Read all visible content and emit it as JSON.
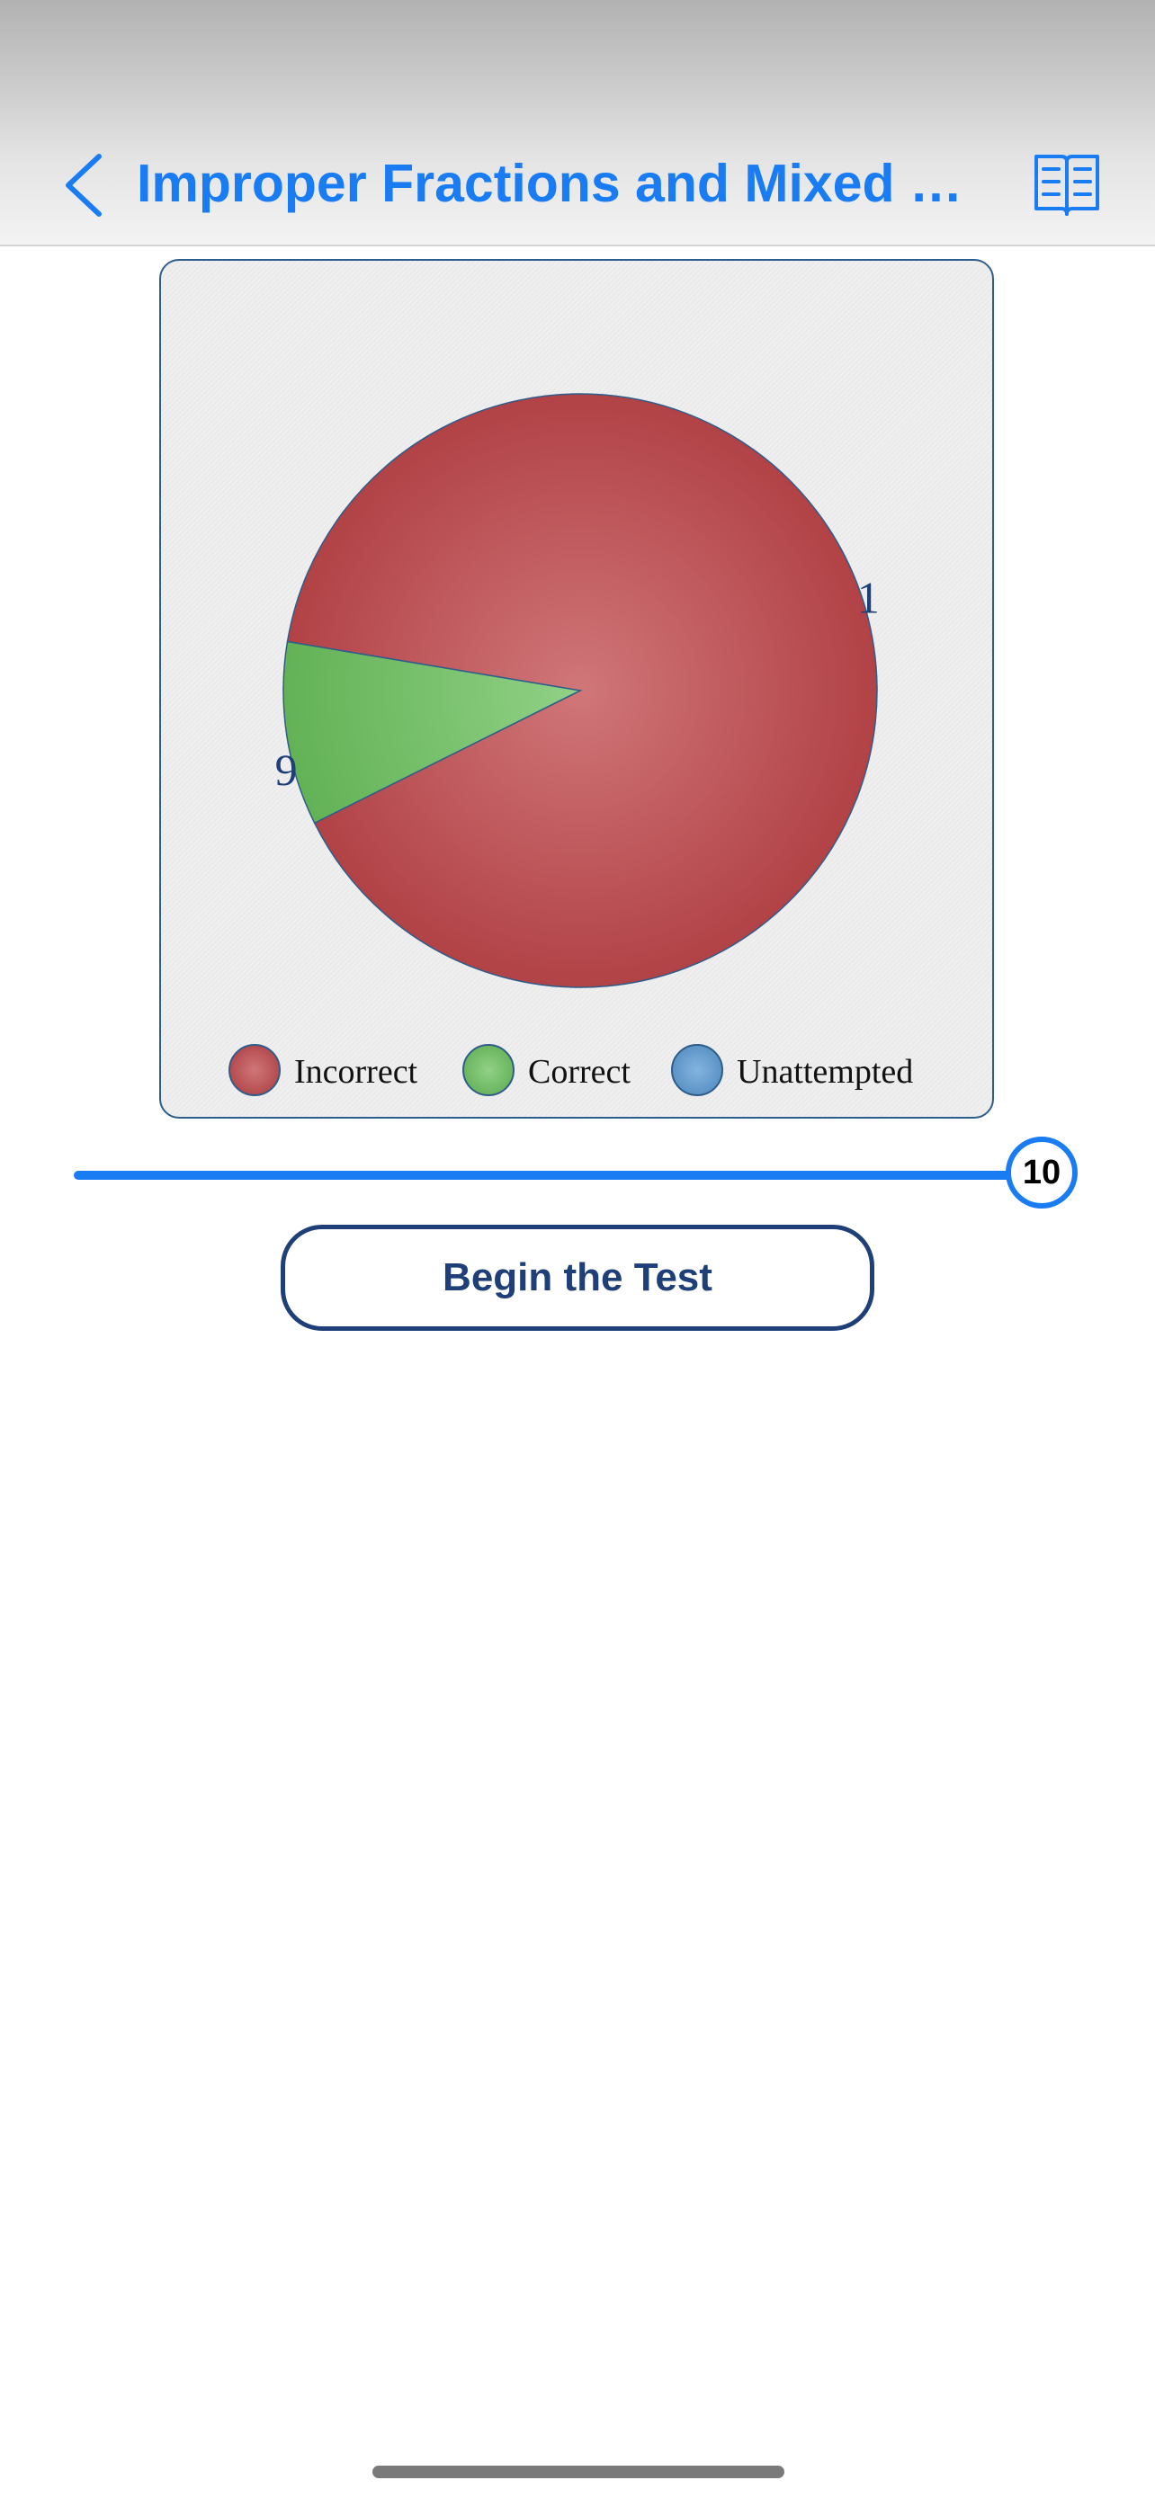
{
  "nav": {
    "title": "Improper Fractions and Mixed Nu...",
    "back_icon": "chevron-left-icon",
    "reader_icon": "book-open-icon",
    "accent_color": "#1a7cf2"
  },
  "chart_data": {
    "type": "pie",
    "slices": [
      {
        "label": "Incorrect",
        "value": 9,
        "color": "#c0484c"
      },
      {
        "label": "Correct",
        "value": 1,
        "color": "#6cc25e"
      },
      {
        "label": "Unattempted",
        "value": 0,
        "color": "#5b9bd5"
      }
    ],
    "data_labels": [
      "9",
      "1"
    ],
    "legend": {
      "placement": "bottom",
      "entries": [
        "Incorrect",
        "Correct",
        "Unattempted"
      ]
    }
  },
  "slider": {
    "value": 10,
    "value_label": "10",
    "fraction": 1.0
  },
  "begin_button": {
    "label": "Begin the Test"
  }
}
